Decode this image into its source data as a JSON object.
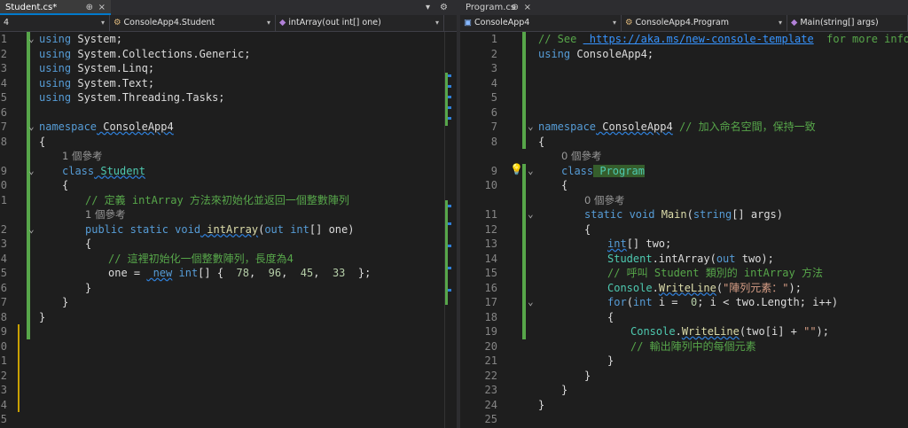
{
  "left": {
    "tab": {
      "label": "Student.cs*",
      "close": "×",
      "pin": "⊕"
    },
    "tab_controls": {
      "dropdown": "▾",
      "settings": "⚙"
    },
    "nav": {
      "project": "4",
      "class": "ConsoleApp4.Student",
      "member": "intArray(out int[] one)"
    },
    "lines": [
      {
        "n": "1",
        "segs": [
          [
            "kw",
            "using"
          ],
          [
            "",
            "System;"
          ]
        ]
      },
      {
        "n": "2",
        "segs": [
          [
            "kw",
            "using"
          ],
          [
            "",
            "System.Collections.Generic;"
          ]
        ]
      },
      {
        "n": "3",
        "segs": [
          [
            "kw",
            "using"
          ],
          [
            "",
            "System.Linq;"
          ]
        ]
      },
      {
        "n": "4",
        "segs": [
          [
            "kw",
            "using"
          ],
          [
            "",
            "System.Text;"
          ]
        ]
      },
      {
        "n": "5",
        "segs": [
          [
            "kw",
            "using"
          ],
          [
            "",
            "System.Threading.Tasks;"
          ]
        ]
      },
      {
        "n": "6",
        "segs": []
      },
      {
        "n": "7",
        "segs": [
          [
            "kw",
            "namespace"
          ],
          [
            "un",
            "ConsoleApp4"
          ]
        ]
      },
      {
        "n": "8",
        "segs": [
          [
            "",
            "{"
          ]
        ]
      },
      {
        "n": "",
        "hint": "1 個參考"
      },
      {
        "n": "9",
        "segs": [
          [
            "kw",
            "class"
          ],
          [
            "ty un",
            "Student"
          ]
        ]
      },
      {
        "n": "0",
        "segs": [
          [
            "",
            "{"
          ]
        ]
      },
      {
        "n": "1",
        "segs": [
          [
            "cm",
            "// 定義 intArray 方法來初始化並返回一個整數陣列"
          ]
        ]
      },
      {
        "n": "",
        "hint": "1 個參考"
      },
      {
        "n": "2",
        "segs": [
          [
            "kw",
            "public static void"
          ],
          [
            "me un",
            "intArray"
          ],
          [
            "",
            "("
          ],
          [
            "kw",
            "out int"
          ],
          [
            "",
            "[] one)"
          ]
        ]
      },
      {
        "n": "3",
        "segs": [
          [
            "",
            "{"
          ]
        ]
      },
      {
        "n": "4",
        "segs": [
          [
            "cm",
            "// 這裡初始化一個整數陣列，長度為4"
          ]
        ]
      },
      {
        "n": "5",
        "segs": [
          [
            "",
            "one = "
          ],
          [
            "kw un",
            "new"
          ],
          [
            "kw",
            "int"
          ],
          [
            "",
            "[] { "
          ],
          [
            "nu",
            "78"
          ],
          [
            "",
            ", "
          ],
          [
            "nu",
            "96"
          ],
          [
            "",
            ", "
          ],
          [
            "nu",
            "45"
          ],
          [
            "",
            ", "
          ],
          [
            "nu",
            "33"
          ],
          [
            "",
            " };"
          ]
        ]
      },
      {
        "n": "6",
        "segs": [
          [
            "",
            "}"
          ]
        ]
      },
      {
        "n": "7",
        "segs": [
          [
            "",
            "}"
          ]
        ]
      },
      {
        "n": "8",
        "segs": [
          [
            "",
            "}"
          ]
        ]
      },
      {
        "n": "9",
        "segs": []
      },
      {
        "n": "0",
        "segs": []
      },
      {
        "n": "1",
        "segs": []
      },
      {
        "n": "2",
        "segs": []
      },
      {
        "n": "3",
        "segs": []
      },
      {
        "n": "4",
        "segs": []
      },
      {
        "n": "5",
        "segs": []
      }
    ]
  },
  "right": {
    "tab": {
      "label": "Program.cs",
      "close": "×",
      "pin": "⊕"
    },
    "nav": {
      "project": "ConsoleApp4",
      "class": "ConsoleApp4.Program",
      "member": "Main(string[] args)"
    },
    "lines": [
      {
        "n": "1",
        "segs": [
          [
            "cm",
            "// See "
          ],
          [
            "lk",
            "https://aka.ms/new-console-template"
          ],
          [
            "cm",
            " for more information"
          ]
        ]
      },
      {
        "n": "2",
        "segs": [
          [
            "kw",
            "using"
          ],
          [
            "",
            "ConsoleApp4;"
          ]
        ]
      },
      {
        "n": "3",
        "segs": []
      },
      {
        "n": "4",
        "segs": []
      },
      {
        "n": "5",
        "segs": []
      },
      {
        "n": "6",
        "segs": []
      },
      {
        "n": "7",
        "segs": [
          [
            "kw",
            "namespace"
          ],
          [
            "un",
            "ConsoleApp4"
          ],
          [
            "cm",
            "// 加入命名空間，保持一致"
          ]
        ]
      },
      {
        "n": "8",
        "segs": [
          [
            "",
            "{"
          ]
        ]
      },
      {
        "n": "",
        "hint": "0 個參考"
      },
      {
        "n": "9",
        "segs": [
          [
            "kw",
            "class"
          ],
          [
            "ty hl",
            "Program"
          ]
        ]
      },
      {
        "n": "10",
        "segs": [
          [
            "",
            "{"
          ]
        ]
      },
      {
        "n": "",
        "hint": "0 個參考"
      },
      {
        "n": "11",
        "segs": [
          [
            "kw",
            "static void"
          ],
          [
            "me",
            "Main"
          ],
          [
            "",
            "("
          ],
          [
            "kw",
            "string"
          ],
          [
            "",
            "[] args)"
          ]
        ]
      },
      {
        "n": "12",
        "segs": [
          [
            "",
            "{"
          ]
        ]
      },
      {
        "n": "13",
        "segs": [
          [
            "kw un",
            "int"
          ],
          [
            "",
            "[] two;"
          ]
        ]
      },
      {
        "n": "14",
        "segs": [
          [
            "ty",
            "Student"
          ],
          [
            "",
            ".intArray("
          ],
          [
            "kw",
            "out"
          ],
          [
            "",
            "two);"
          ]
        ]
      },
      {
        "n": "15",
        "segs": [
          [
            "cm",
            "// 呼叫 Student 類別的 intArray 方法"
          ]
        ]
      },
      {
        "n": "16",
        "segs": [
          [
            "ty",
            "Console"
          ],
          [
            "",
            "."
          ],
          [
            "me un",
            "WriteLine"
          ],
          [
            "",
            "("
          ],
          [
            "st",
            "\"陣列元素：\""
          ],
          [
            "",
            ");"
          ]
        ]
      },
      {
        "n": "17",
        "segs": [
          [
            "kw",
            "for"
          ],
          [
            "",
            "("
          ],
          [
            "kw",
            "int"
          ],
          [
            "",
            "i = "
          ],
          [
            "nu",
            "0"
          ],
          [
            "",
            "; i < two.Length; i++)"
          ]
        ]
      },
      {
        "n": "18",
        "segs": [
          [
            "",
            "{"
          ]
        ]
      },
      {
        "n": "19",
        "segs": [
          [
            "ty",
            "Console"
          ],
          [
            "",
            "."
          ],
          [
            "me un",
            "WriteLine"
          ],
          [
            "",
            "(two[i] + "
          ],
          [
            "st",
            "\"\""
          ],
          [
            "",
            ");"
          ]
        ]
      },
      {
        "n": "20",
        "segs": [
          [
            "cm",
            "// 輸出陣列中的每個元素"
          ]
        ]
      },
      {
        "n": "21",
        "segs": [
          [
            "",
            "}"
          ]
        ]
      },
      {
        "n": "22",
        "segs": [
          [
            "",
            "}"
          ]
        ]
      },
      {
        "n": "23",
        "segs": [
          [
            "",
            "}"
          ]
        ]
      },
      {
        "n": "24",
        "segs": [
          [
            "",
            "}"
          ]
        ]
      },
      {
        "n": "25",
        "segs": []
      }
    ]
  },
  "colors": {
    "accent": "#007acc",
    "change_bar": "#57a64a",
    "keyword": "#569cd6",
    "type": "#4ec9b0",
    "comment": "#57a64a"
  }
}
